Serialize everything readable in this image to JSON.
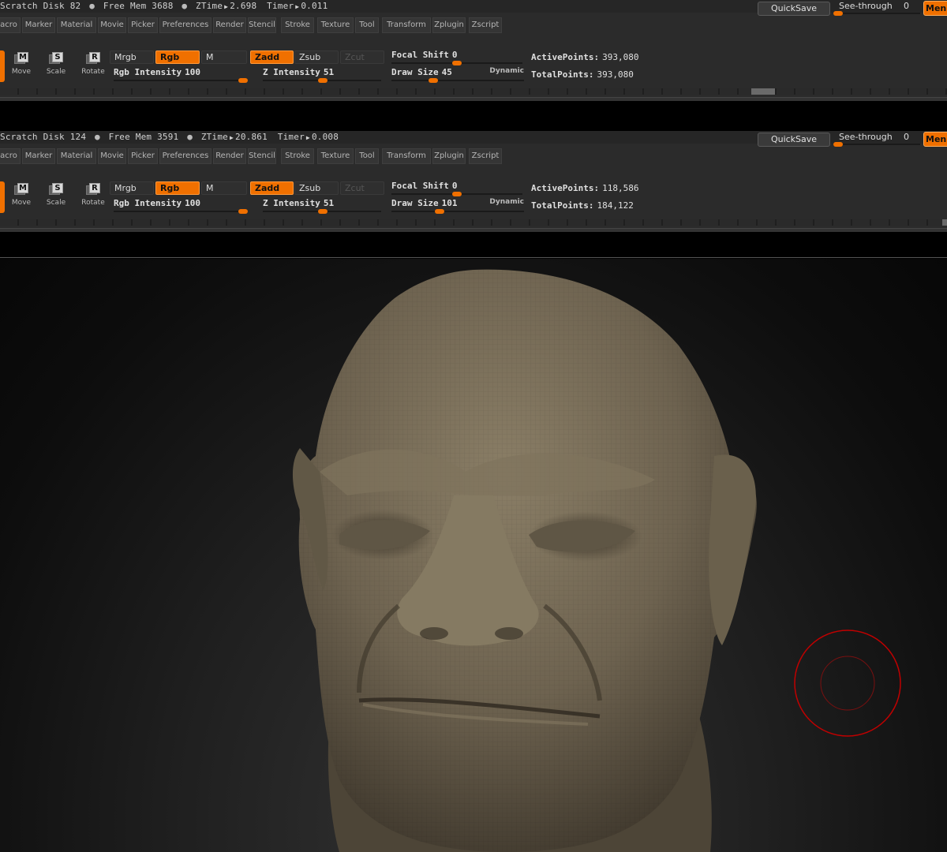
{
  "app": "ZBrush",
  "menus": [
    "acro",
    "Marker",
    "Material",
    "Movie",
    "Picker",
    "Preferences",
    "Render",
    "Stencil",
    "Stroke",
    "Texture",
    "Tool",
    "Transform",
    "Zplugin",
    "Zscript"
  ],
  "panels": [
    {
      "status": {
        "scratch_label": "Scratch Disk",
        "scratch": "82",
        "mem_label": "Free Mem",
        "mem": "3688",
        "ztime_label": "ZTime",
        "ztime": "2.698",
        "timer_label": "Timer",
        "timer": "0.011"
      },
      "quicksave": "QuickSave",
      "seethrough_label": "See-through",
      "seethrough_value": "0",
      "seethrough_level": 0,
      "menus_btn": "Menus",
      "tools": {
        "move": "Move",
        "scale": "Scale",
        "rotate": "Rotate",
        "move_key": "M",
        "scale_key": "S",
        "rotate_key": "R"
      },
      "buttons": {
        "mrgb": "Mrgb",
        "rgb": "Rgb",
        "m": "M",
        "zadd": "Zadd",
        "zsub": "Zsub",
        "zcut": "Zcut"
      },
      "rgb_intensity": {
        "label": "Rgb  Intensity",
        "value": "100",
        "level": 1.0
      },
      "z_intensity": {
        "label": "Z  Intensity",
        "value": "51",
        "level": 0.51
      },
      "focal_shift": {
        "label": "Focal  Shift",
        "value": "0",
        "level": 0.5
      },
      "draw_size": {
        "label": "Draw  Size",
        "value": "45",
        "level": 0.3,
        "tag": "Dynamic"
      },
      "active_points": {
        "label": "ActivePoints:",
        "value": "393,080"
      },
      "total_points": {
        "label": "TotalPoints:",
        "value": "393,080"
      }
    },
    {
      "status": {
        "scratch_label": "Scratch Disk",
        "scratch": "124",
        "mem_label": "Free Mem",
        "mem": "3591",
        "ztime_label": "ZTime",
        "ztime": "20.861",
        "timer_label": "Timer",
        "timer": "0.008"
      },
      "quicksave": "QuickSave",
      "seethrough_label": "See-through",
      "seethrough_value": "0",
      "seethrough_level": 0,
      "menus_btn": "Menus",
      "tools": {
        "move": "Move",
        "scale": "Scale",
        "rotate": "Rotate",
        "move_key": "M",
        "scale_key": "S",
        "rotate_key": "R"
      },
      "buttons": {
        "mrgb": "Mrgb",
        "rgb": "Rgb",
        "m": "M",
        "zadd": "Zadd",
        "zsub": "Zsub",
        "zcut": "Zcut"
      },
      "rgb_intensity": {
        "label": "Rgb  Intensity",
        "value": "100",
        "level": 1.0
      },
      "z_intensity": {
        "label": "Z  Intensity",
        "value": "51",
        "level": 0.51
      },
      "focal_shift": {
        "label": "Focal  Shift",
        "value": "0",
        "level": 0.5
      },
      "draw_size": {
        "label": "Draw  Size",
        "value": "101",
        "level": 0.35,
        "tag": "Dynamic"
      },
      "active_points": {
        "label": "ActivePoints:",
        "value": "118,586"
      },
      "total_points": {
        "label": "TotalPoints:",
        "value": "184,122"
      }
    }
  ],
  "colors": {
    "accent": "#f07000",
    "panel": "#2b2b2b",
    "clay": "#6e6350",
    "brush_cursor": "#c00000"
  }
}
